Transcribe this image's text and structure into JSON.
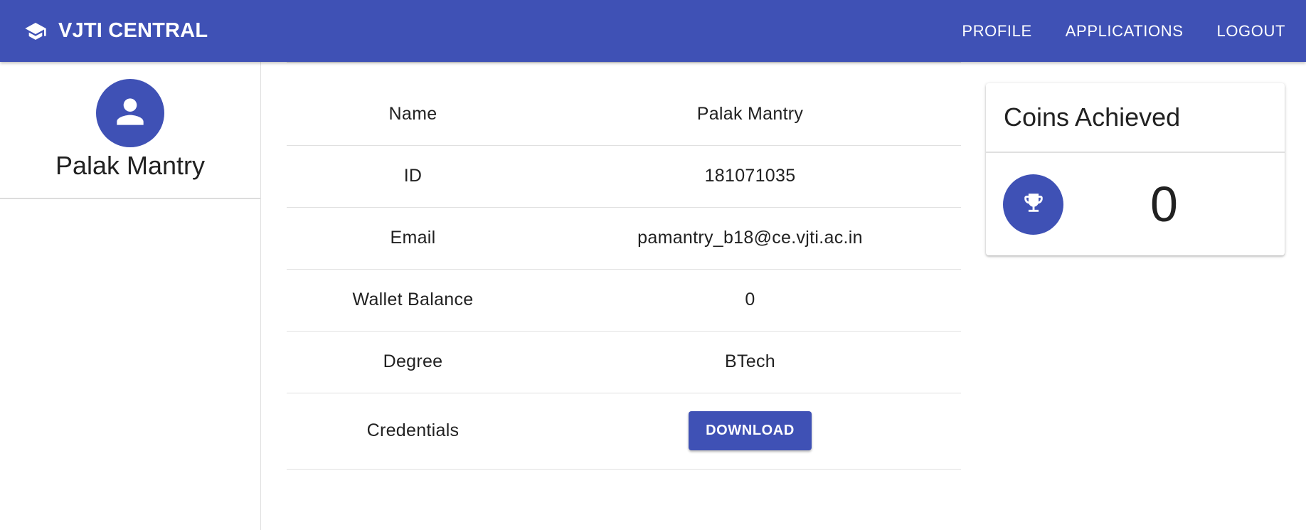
{
  "appbar": {
    "brand_icon": "graduation-cap-icon",
    "title": "VJTI CENTRAL",
    "nav": [
      "PROFILE",
      "APPLICATIONS",
      "LOGOUT"
    ],
    "color": "#3f51b5"
  },
  "sidebar": {
    "avatar_icon": "person-icon",
    "name": "Palak Mantry"
  },
  "details": {
    "rows": [
      {
        "label": "Name",
        "value": "Palak Mantry"
      },
      {
        "label": "ID",
        "value": "181071035"
      },
      {
        "label": "Email",
        "value": "pamantry_b18@ce.vjti.ac.in"
      },
      {
        "label": "Wallet Balance",
        "value": "0"
      },
      {
        "label": "Degree",
        "value": "BTech"
      }
    ],
    "credentials_label": "Credentials",
    "download_label": "DOWNLOAD"
  },
  "coins": {
    "title": "Coins Achieved",
    "icon": "trophy-icon",
    "value": "0"
  }
}
